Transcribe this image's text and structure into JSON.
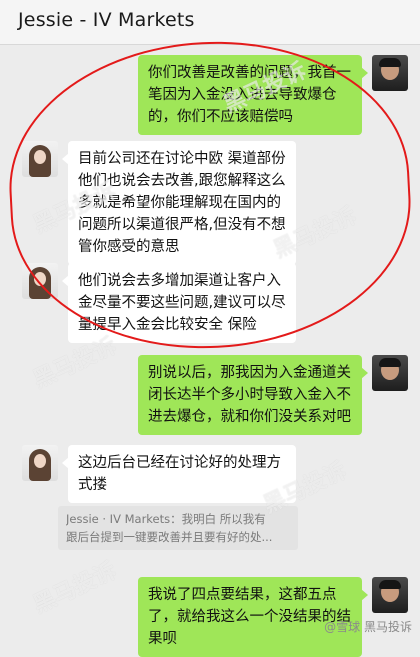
{
  "header": {
    "title": "Jessie - IV Markets"
  },
  "messages": [
    {
      "text": "你们改善是改善的问题，我首一笔因为入金没入进去导致爆仓的，你们不应该赔偿吗"
    },
    {
      "text": "目前公司还在讨论中欧 渠道部份他们也说会去改善,跟您解释这么多就是希望你能理解现在国内的问题所以渠道很严格,但没有不想管你感受的意思"
    },
    {
      "text": "他们说会去多增加渠道让客户入金尽量不要这些问题,建议可以尽量提早入金会比较安全 保险"
    },
    {
      "text": "别说以后，那我因为入金通道关闭长达半个多小时导致入金入不进去爆仓，就和你们没关系对吧"
    },
    {
      "text": "这边后台已经在讨论好的处理方式搂"
    },
    {
      "text": "我说了四点要结果，这都五点了，就给我这么一个没结果的结果呗"
    }
  ],
  "quote": {
    "line1": "Jessie · IV Markets：我明白 所以我有",
    "line2": "跟后台提到一键要改善并且要有好的处..."
  },
  "watermark": {
    "text": "黑马投诉",
    "footer": "@雪球 黑马投诉"
  }
}
